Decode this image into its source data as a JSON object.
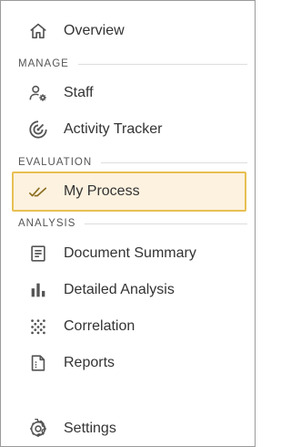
{
  "nav": {
    "overview": {
      "label": "Overview",
      "icon": "home-icon"
    },
    "manage_header": "MANAGE",
    "staff": {
      "label": "Staff",
      "icon": "user-settings-icon"
    },
    "activity": {
      "label": "Activity Tracker",
      "icon": "radar-icon"
    },
    "evaluation_header": "EVALUATION",
    "my_process": {
      "label": "My Process",
      "icon": "double-check-icon",
      "active": true
    },
    "analysis_header": "ANALYSIS",
    "doc_summary": {
      "label": "Document Summary",
      "icon": "document-icon"
    },
    "detailed": {
      "label": "Detailed Analysis",
      "icon": "bar-chart-icon"
    },
    "correlation": {
      "label": "Correlation",
      "icon": "dots-grid-icon"
    },
    "reports": {
      "label": "Reports",
      "icon": "report-file-icon"
    },
    "settings": {
      "label": "Settings",
      "icon": "gear-icon"
    }
  },
  "colors": {
    "active_background": "#fdf2e0",
    "active_border": "#e7c052",
    "active_icon": "#8a6d1e",
    "icon": "#555555",
    "text": "#333333"
  }
}
